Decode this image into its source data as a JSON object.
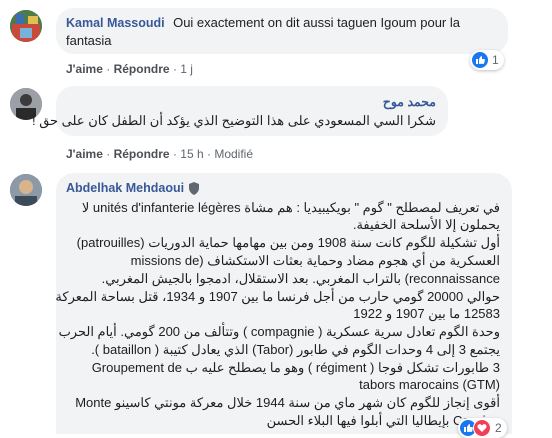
{
  "comments": [
    {
      "author": "Kamal Massoudi",
      "text": "Oui exactement on dit aussi taguen Igoum pour la fantasia",
      "text_line1": "Oui exactement on dit aussi taguen Igoum pour la",
      "text_line2": "fantasia",
      "like_label": "J'aime",
      "reply_label": "Répondre",
      "time": "1 j",
      "reaction_count": "1"
    },
    {
      "author": "محمد موح",
      "text": "شكرا السي المسعودي على هذا التوضيح الذي يؤكد أن الطفل كان على حق !",
      "like_label": "J'aime",
      "reply_label": "Répondre",
      "time": "15 h",
      "edited_label": "Modifié"
    },
    {
      "author": "Abdelhak Mehdaoui",
      "lines": [
        "في تعريف لمصطلح \" گوم \" بويكيبيديا : هم مشاة unités d'infanterie légères لا",
        "يحملون إلا الأسلحة الخفيفة.",
        "أول تشكيلة للگوم كانت سنة 1908 ومن بين مهامها حماية الدوريات (patrouilles)",
        "العسكرية من أي هجوم مضاد وحماية بعثات الاستكشاف (missions de",
        "reconnaissance) بالتراب المغربي. بعد الاستقلال، ادمجوا بالجيش المغربي.",
        "حوالي 20000 گومي حارب من أجل فرنسا ما بين 1907 و 1934، قتل بساحة المعركة",
        "12583 ما بين 1907 و 1922",
        "وحدة الگوم تعادل سرية عسكرية ( compagnie ) وتتألف من 200 گومي. أيام الحرب",
        "يجتمع 3 إلى 4 وحدات الگوم في طابور (Tabor) الذي يعادل كتيبة ( bataillon ).",
        "3 طابورات تشكل فوجا ( régiment ) وهو ما يصطلح عليه ب Groupement de",
        "tabors marocains (GTM)",
        "أقوى إنجاز للگوم كان شهر ماي من سنة 1944 خلال معركة مونتي كاسينو Monte",
        "Cassino بإيطاليا التي أبلوا فيها البلاء الحسن"
      ],
      "reaction_count": "2"
    }
  ],
  "colors": {
    "author": "#385898",
    "bubble": "#f2f3f5",
    "like": "#1877f2",
    "love": "#f33e58"
  }
}
